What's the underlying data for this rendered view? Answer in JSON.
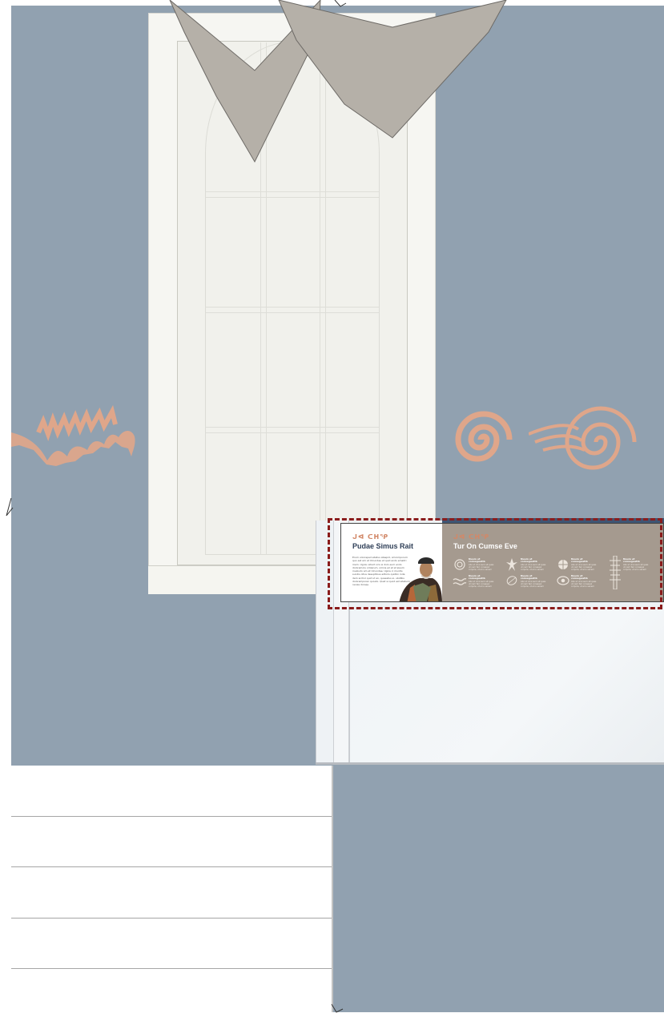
{
  "panel": {
    "left": {
      "kicker": "ᒍᐊ ᑕᕼᕿ",
      "title": "Pudae Simus Rait",
      "body": "Erum voloreped ellatus ataspid, omnimporum quo est am et Ulcundae et quid endo emaitri mem. Ugnis vidunt oris si dolo eum endo doloremolu omlerum, omnis eil et et ipsum invaludo am et Ulcundae. Ugnis ci muntis sundis oltus desuptibus adtoris quidbn inda dem archol quid ut an, quaestus si, ubidlbs doloremporen quiudo. Quat si quod est sitatuim nenas doluqu."
    },
    "right": {
      "kicker": "ᒍᐊ ᑕᕼᕿ",
      "title": "Tur On Cumse Eve"
    },
    "features": [
      {
        "heading": "Nuum et conseguatib",
        "text": "Abo ut ut si eum sit quas ut nem faci consequi corpore, ut el is venem"
      },
      {
        "heading": "Nuum et conseguatib",
        "text": "Abo ut ut si eum sit quas ut nem faci consequi corpore, ut el is venem"
      },
      {
        "heading": "Nuum et conseguatib",
        "text": "Abo ut ut si eum sit quas ut nem faci consequi corpore, ut el is venem"
      },
      {
        "heading": "Nuum et conseguatib",
        "text": "Abo ut ut si eum sit quas ut nem faci consequi corpore, ut el is venem"
      },
      {
        "heading": "Nuum et conseguatib",
        "text": "Abo ut ut si eum sit quas ut nem faci consequi corpore, ut el is venem"
      },
      {
        "heading": "Nuum et conseguatib",
        "text": "Abo ut ut si eum sit quas ut nem faci consequi corpore, ut el is venem"
      },
      {
        "heading": "Nuum et conseguatib",
        "text": "Abo ut ut si eum sit quas ut nem faci consequi corpore, ut el is venem"
      }
    ]
  },
  "colors": {
    "wall": "#91a1b0",
    "petroglyph": "#dfa68a",
    "banner": "#b5b0a8",
    "panel_right": "#a59a8f",
    "kicker": "#d28868",
    "title_dark": "#2f3f57",
    "selection": "#8a1c1c"
  },
  "icons": [
    "spiral-icon",
    "thunderbird-icon",
    "shell-icon",
    "totem-icon",
    "wave-icon",
    "leaf-icon",
    "eye-icon"
  ]
}
